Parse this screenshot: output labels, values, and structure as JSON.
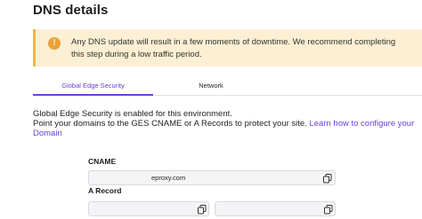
{
  "page": {
    "title": "DNS details"
  },
  "alert": {
    "line1": "Any DNS update will result in a few moments of downtime. We recommend completing",
    "line2": "this step during a low traffic period.",
    "icon": "warning-icon"
  },
  "tabs": [
    {
      "label": "Global Edge Security",
      "active": true
    },
    {
      "label": "Network",
      "active": false
    }
  ],
  "info": {
    "line1": "Global Edge Security is enabled for this environment.",
    "line2_prefix": "Point your domains to the GES CNAME or A Records to protect your site.",
    "link_part1": "Learn how to configure your",
    "link_part2": "Domain"
  },
  "cname": {
    "label": "CNAME",
    "value": "eproxy.com"
  },
  "a_record": {
    "label": "A Record"
  },
  "colors": {
    "accent": "#6a3fd9",
    "alert_bg": "#fcefd3",
    "alert_border": "#f1b74a"
  }
}
